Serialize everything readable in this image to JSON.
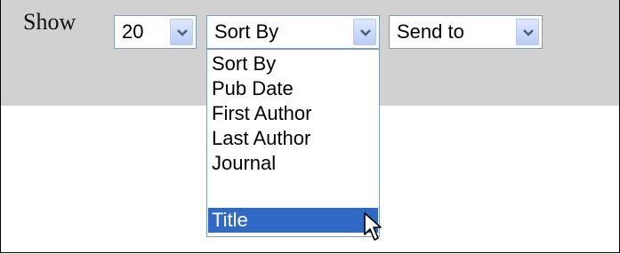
{
  "toolbar": {
    "show_label": "Show",
    "per_page": {
      "value": "20"
    },
    "sort_by": {
      "value": "Sort By"
    },
    "send_to": {
      "value": "Send to"
    }
  },
  "sort_dropdown": {
    "options": [
      "Sort By",
      "Pub Date",
      "First Author",
      "Last Author",
      "Journal",
      "Title"
    ],
    "highlighted": "Title"
  },
  "colors": {
    "toolbar_bg": "#d1d1d1",
    "highlight": "#316ac5",
    "select_border": "#7f9db9"
  },
  "icons": [
    "chevron-down-icon",
    "mouse-cursor-icon"
  ]
}
